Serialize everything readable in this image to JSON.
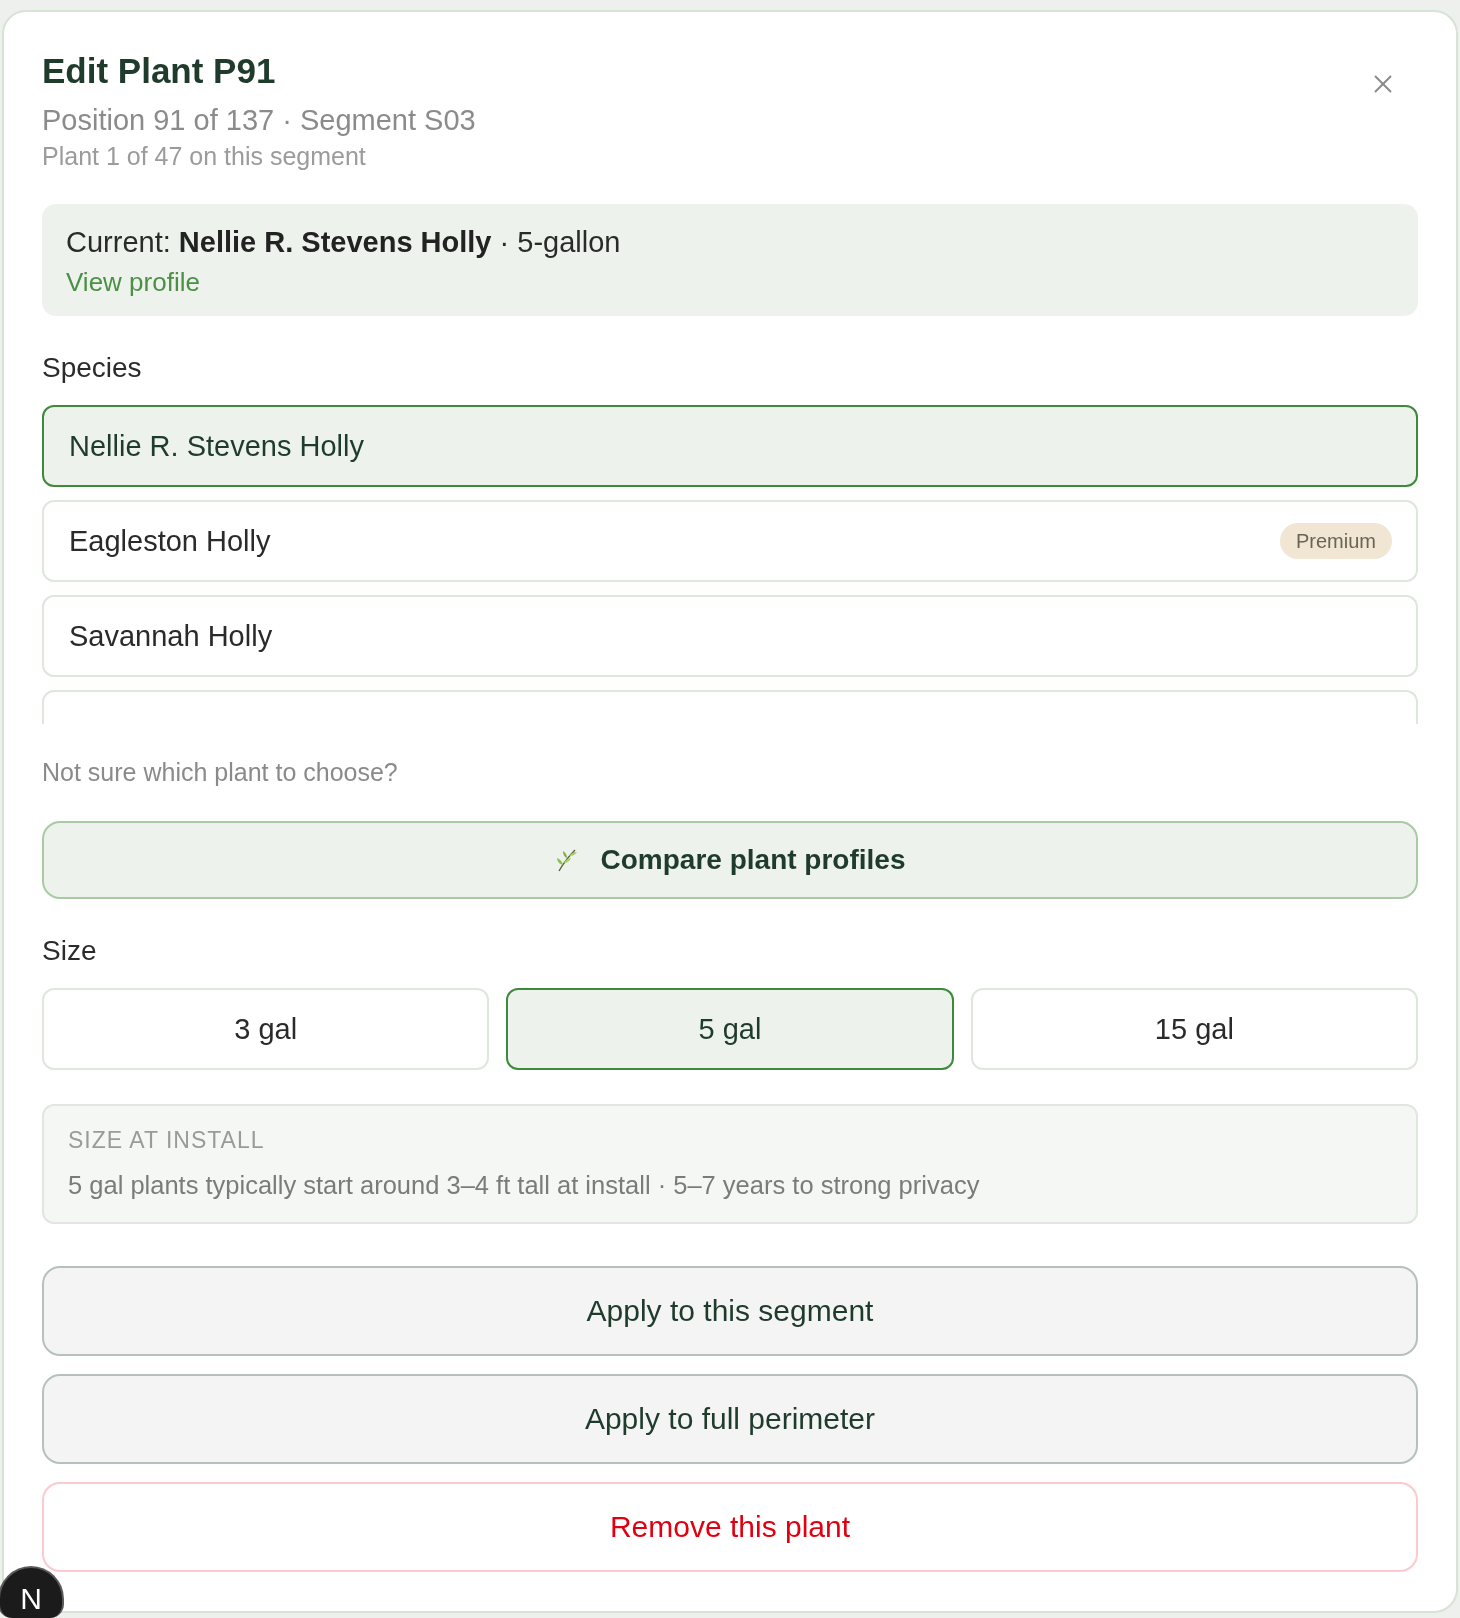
{
  "dialog": {
    "title": "Edit Plant P91",
    "subtitle": "Position 91 of 137 · Segment S03",
    "note": "Plant 1 of 47 on this segment"
  },
  "current": {
    "text": "Current: **Nellie R. Stevens Holly** · 5-gallon",
    "link": "View profile"
  },
  "species": {
    "label": "Species",
    "options": [
      {
        "kind": "option",
        "name": "Nellie R. Stevens Holly",
        "selected": true
      },
      {
        "kind": "option",
        "name": "Eagleston Holly",
        "badge": "Premium",
        "selected": false
      },
      {
        "kind": "option",
        "name": "Savannah Holly",
        "selected": false
      },
      {
        "kind": "cut_off",
        "selected": false
      }
    ]
  },
  "help": {
    "text": "Not sure which plant to choose?",
    "button": "Compare plant profiles"
  },
  "size": {
    "label": "Size",
    "options": [
      {
        "label": "3 gal",
        "selected": false
      },
      {
        "label": "5 gal",
        "selected": true
      },
      {
        "label": "15 gal",
        "selected": false
      }
    ],
    "info": {
      "heading": "SIZE AT INSTALL",
      "text": "5 gal plants typically start around 3–4 ft tall at install · 5–7 years to strong privacy"
    }
  },
  "actions": [
    {
      "kind": "secondary",
      "label": "Apply to this segment"
    },
    {
      "kind": "secondary",
      "label": "Apply to full perimeter"
    },
    {
      "kind": "danger",
      "label": "Remove this plant"
    }
  ],
  "dev_badge": {
    "label": "N"
  }
}
